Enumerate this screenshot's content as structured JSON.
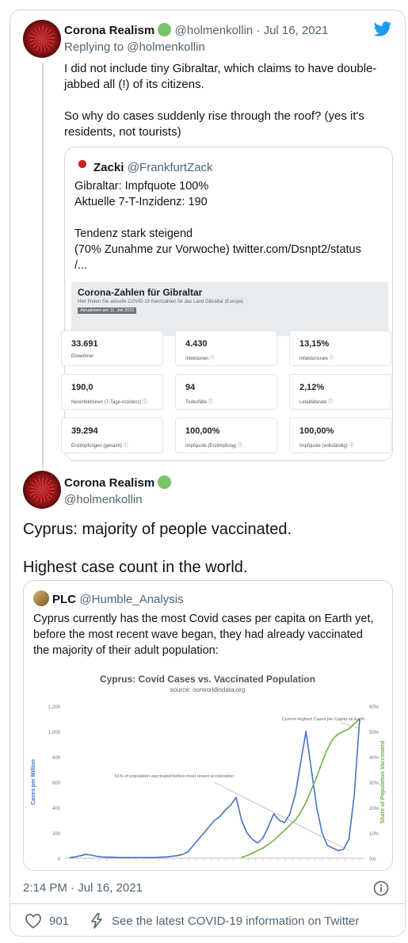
{
  "reply_tweet": {
    "name": "Corona Realism",
    "handle_date": "@holmenkollin · Jul 16, 2021",
    "replying_to": "Replying to @holmenkollin",
    "text_line1": "I did not include tiny Gibraltar, which claims to have double-",
    "text_line2": "jabbed all (!) of its citizens.",
    "text_line3": "So why do cases suddenly rise through the roof? (yes it's",
    "text_line4": "residents, not tourists)"
  },
  "quote1": {
    "name": "Zacki",
    "handle": "@FrankfurtZack",
    "line1": "Gibraltar: Impfquote 100%",
    "line2": "Aktuelle 7-T-Inzidenz: 190",
    "line3": "Tendenz stark steigend",
    "line4": "(70% Zunahme zur Vorwoche) twitter.com/Dsnpt2/status",
    "line5": "/...",
    "panel_title": "Corona-Zahlen für Gibraltar",
    "panel_sub": "Hier finden Sie aktuelle COVID-19 Kennzahlen für das Land Gibraltar (Europa)",
    "panel_updated": "Aktualisiert am 11. Juli 2021",
    "stats": [
      {
        "value": "33.691",
        "label": "Einwohner"
      },
      {
        "value": "4.430",
        "label": "Infektionen ⓘ"
      },
      {
        "value": "13,15%",
        "label": "Infektionsrate ⓘ"
      },
      {
        "value": "190,0",
        "label": "Neuinfektionen (7-Tage-Inzidenz) ⓘ"
      },
      {
        "value": "94",
        "label": "Todesfälle ⓘ"
      },
      {
        "value": "2,12%",
        "label": "Letalitätsrate ⓘ"
      },
      {
        "value": "39.294",
        "label": "Erstimpfungen (gesamt) ⓘ"
      },
      {
        "value": "100,00%",
        "label": "Impfquote (Erstimpfung) ⓘ"
      },
      {
        "value": "100,00%",
        "label": "Impfquote (vollständig) ⓘ"
      }
    ]
  },
  "main_tweet": {
    "name": "Corona Realism",
    "handle": "@holmenkollin",
    "text1": "Cyprus: majority of people vaccinated.",
    "text2": "Highest case count in the world.",
    "timestamp": "2:14 PM · Jul 16, 2021",
    "likes": "901",
    "covid_link": "See the latest COVID-19 information on Twitter"
  },
  "quote2": {
    "name": "PLC",
    "handle": "@Humble_Analysis",
    "line1": "Cyprus currently has the most Covid cases per capita on Earth yet,",
    "line2": "before the most recent wave began, they had already vaccinated",
    "line3": "the majority of their adult population:"
  },
  "chart_data": {
    "type": "line",
    "title": "Cyprus: Covid Cases vs. Vaccinated Population",
    "subtitle": "source: ourworldindata.org",
    "ylabel": "Cases per Million",
    "y2label": "Share of Population Vaccinated",
    "ylim": [
      0,
      1200
    ],
    "y2lim": [
      0,
      60
    ],
    "yticks": [
      "0",
      "200",
      "400",
      "600",
      "800",
      "1,000",
      "1,200"
    ],
    "y2ticks": [
      "0%",
      "10%",
      "20%",
      "30%",
      "40%",
      "50%",
      "60%"
    ],
    "annotations": [
      "Current Highest Cases per Capita on Earth",
      "51% of population vaccinated before most recent acceleration"
    ],
    "grid": false,
    "series": [
      {
        "color": "#4472c4",
        "axis": "left",
        "values": [
          5,
          10,
          20,
          30,
          25,
          15,
          10,
          8,
          8,
          5,
          5,
          5,
          5,
          5,
          5,
          5,
          5,
          8,
          10,
          15,
          20,
          30,
          50,
          100,
          150,
          200,
          250,
          300,
          330,
          380,
          420,
          480,
          300,
          200,
          150,
          120,
          160,
          250,
          350,
          300,
          280,
          350,
          500,
          750,
          1000,
          700,
          400,
          200,
          100,
          80,
          60,
          70,
          150,
          500,
          1100
        ]
      },
      {
        "color": "#70ad47",
        "axis": "right",
        "values": [
          null,
          null,
          null,
          null,
          null,
          null,
          null,
          null,
          null,
          null,
          null,
          null,
          null,
          null,
          null,
          null,
          null,
          null,
          null,
          null,
          null,
          null,
          null,
          null,
          null,
          null,
          null,
          null,
          null,
          null,
          null,
          null,
          0.3,
          1,
          2,
          3,
          4,
          5.5,
          7,
          9,
          11,
          13,
          15,
          18,
          22,
          27,
          32,
          38,
          43,
          47,
          49,
          50,
          51,
          53,
          55
        ]
      }
    ]
  },
  "colors": {
    "accent": "#1d9bf0",
    "verified": "#79c36b",
    "muted": "#536471"
  }
}
